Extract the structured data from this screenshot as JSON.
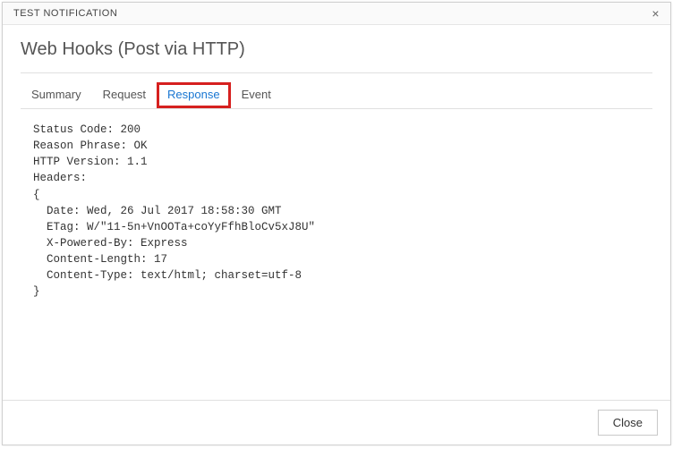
{
  "titlebar": {
    "title": "TEST NOTIFICATION",
    "close_glyph": "×"
  },
  "header": {
    "title": "Web Hooks (Post via HTTP)"
  },
  "tabs": {
    "summary": "Summary",
    "request": "Request",
    "response": "Response",
    "event": "Event"
  },
  "response_body": "Status Code: 200\nReason Phrase: OK\nHTTP Version: 1.1\nHeaders:\n{\n  Date: Wed, 26 Jul 2017 18:58:30 GMT\n  ETag: W/\"11-5n+VnOOTa+coYyFfhBloCv5xJ8U\"\n  X-Powered-By: Express\n  Content-Length: 17\n  Content-Type: text/html; charset=utf-8\n}",
  "footer": {
    "close_label": "Close"
  }
}
